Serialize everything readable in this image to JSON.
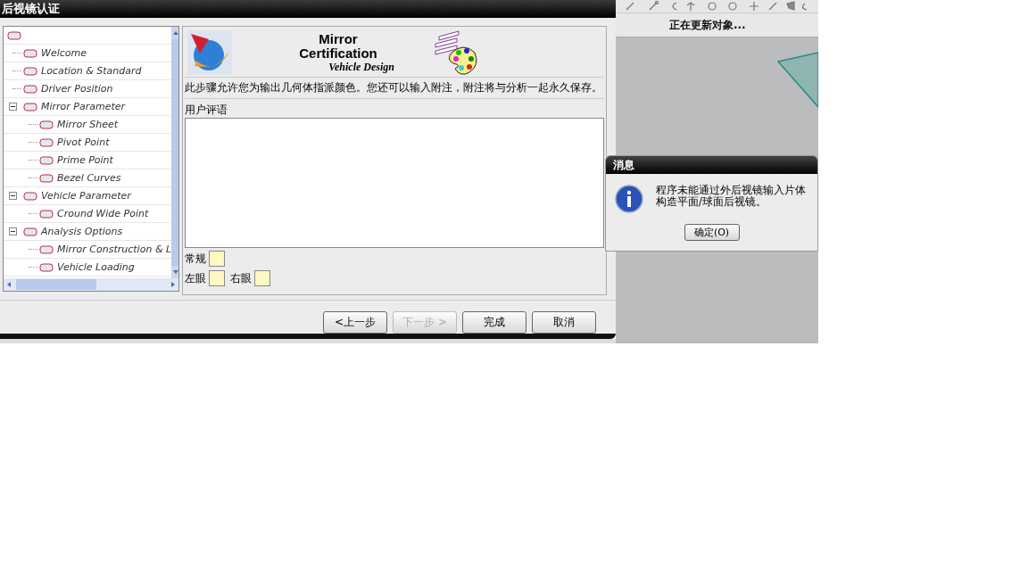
{
  "dialog": {
    "title": "后视镜认证",
    "tree": {
      "children": [
        {
          "label": "Welcome"
        },
        {
          "label": "Location & Standard"
        },
        {
          "label": "Driver Position"
        },
        {
          "label": "Mirror Parameter",
          "expanded": true,
          "children": [
            {
              "label": "Mirror Sheet"
            },
            {
              "label": "Pivot Point"
            },
            {
              "label": "Prime Point"
            },
            {
              "label": "Bezel Curves"
            }
          ]
        },
        {
          "label": "Vehicle Parameter",
          "expanded": true,
          "children": [
            {
              "label": "Cround Wide Point"
            }
          ]
        },
        {
          "label": "Analysis Options",
          "expanded": true,
          "children": [
            {
              "label": "Mirror Construction & L"
            },
            {
              "label": "Vehicle Loading"
            }
          ]
        }
      ]
    },
    "banner": {
      "title_line_1": "Mirror",
      "title_line_2": "Certification",
      "subtitle": "Vehicle Design"
    },
    "description": "此步骤允许您为输出几何体指派颜色。您还可以输入附注，附注将与分析一起永久保存。",
    "comments_label": "用户评语",
    "swatch_rows": [
      [
        {
          "label": "常规",
          "color": "#fff8c0"
        }
      ],
      [
        {
          "label": "左眼",
          "color": "#fff8c0"
        },
        {
          "label": "右眼",
          "color": "#fff8c0"
        }
      ]
    ],
    "buttons": [
      {
        "label": "<上一步",
        "disabled": false
      },
      {
        "label": "下一步 >",
        "disabled": true
      },
      {
        "label": "完成",
        "disabled": false
      },
      {
        "label": "取消",
        "disabled": false
      }
    ]
  },
  "status": "正在更新对象...",
  "message": {
    "title": "消息",
    "text": "程序未能通过外后视镜输入片体构造平面/球面后视镜。",
    "button": "确定(O)"
  }
}
